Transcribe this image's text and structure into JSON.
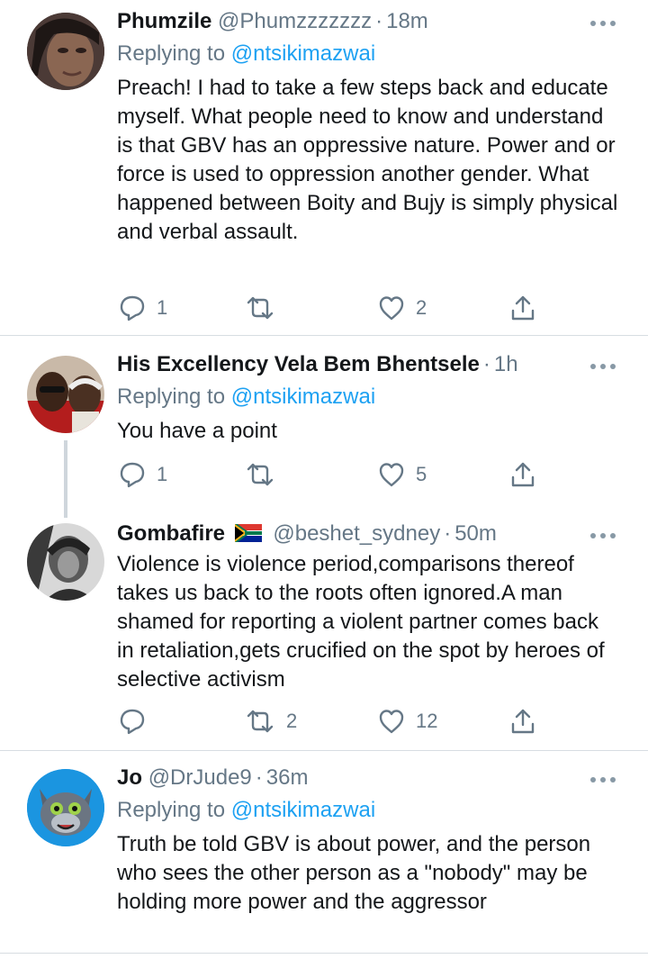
{
  "tweets": [
    {
      "name": "Phumzile",
      "handle": "@Phumzzzzzzz",
      "time": "18m",
      "replying_label": "Replying to",
      "replying_to": "@ntsikimazwai",
      "text": "Preach! I had to take a few steps back and educate myself. What people need to know and understand is that GBV has an oppressive nature. Power and or force is used to oppression another gender. What happened between Boity and Bujy is simply physical and verbal assault.",
      "replies": "1",
      "retweets": "",
      "likes": "2"
    },
    {
      "name": "His Excellency Vela Bem Bhentsele",
      "handle": "",
      "time": "1h",
      "replying_label": "Replying to",
      "replying_to": "@ntsikimazwai",
      "text": "You have a point",
      "replies": "1",
      "retweets": "",
      "likes": "5"
    },
    {
      "name": "Gombafire",
      "flag_icon": "south-africa-flag-icon",
      "handle": "@beshet_sydney",
      "time": "50m",
      "text": "Violence is violence period,comparisons thereof takes us back to the roots often ignored.A man shamed for reporting a violent partner comes back in retaliation,gets crucified on the spot by heroes of selective activism",
      "replies": "",
      "retweets": "2",
      "likes": "12"
    },
    {
      "name": "Jo",
      "handle": "@DrJude9",
      "time": "36m",
      "replying_label": "Replying to",
      "replying_to": "@ntsikimazwai",
      "text": "Truth be told GBV is about power, and the person who sees the other person as a \"nobody\" may be holding more power and the aggressor"
    }
  ],
  "separator": "·",
  "colors": {
    "link": "#1da1f2",
    "muted": "#657786",
    "text": "#14171a",
    "divider": "#d7dde2"
  }
}
